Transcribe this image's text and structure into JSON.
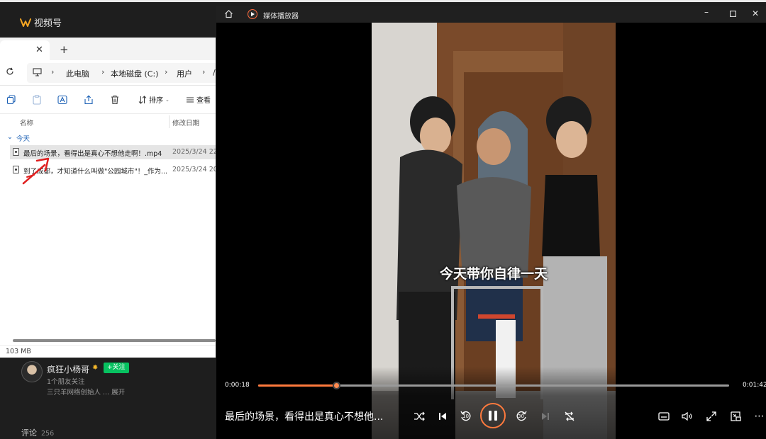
{
  "background_app": {
    "name": "视频号"
  },
  "explorer": {
    "tab_close": "✕",
    "tab_add": "+",
    "breadcrumb": [
      "此电脑",
      "本地磁盘 (C:)",
      "用户"
    ],
    "breadcrumb_overflow": "/",
    "toolbar": {
      "sort_label": "排序",
      "view_label": "查看"
    },
    "columns": {
      "name": "名称",
      "modified": "修改日期"
    },
    "group": "今天",
    "files": [
      {
        "name": "最后的场景，看得出是真心不想他走啊！.mp4",
        "date": "2025/3/24 22",
        "selected": true
      },
      {
        "name": "到了成都，才知道什么叫做\"公园城市\"！_作为...",
        "date": "2025/3/24 20",
        "selected": false
      }
    ],
    "status_size": "103 MB"
  },
  "creator": {
    "name": "疯狂小杨哥",
    "follow_label": "+关注",
    "friends_follow": "1个朋友关注",
    "desc": "三只羊网络创始人 ... 展开",
    "comments_label": "评论",
    "comments_count": "256"
  },
  "player": {
    "app_title": "媒体播放器",
    "subtitle": "今天带你自律一天",
    "time_current": "0:00:18",
    "time_total": "0:01:42",
    "progress": 0.166,
    "now_playing": "最后的场景，看得出是真心不想他...",
    "skip_back_label": "10",
    "skip_forward_label": "30"
  },
  "colors": {
    "accent": "#ff7a3d",
    "follow_green": "#07c160"
  }
}
